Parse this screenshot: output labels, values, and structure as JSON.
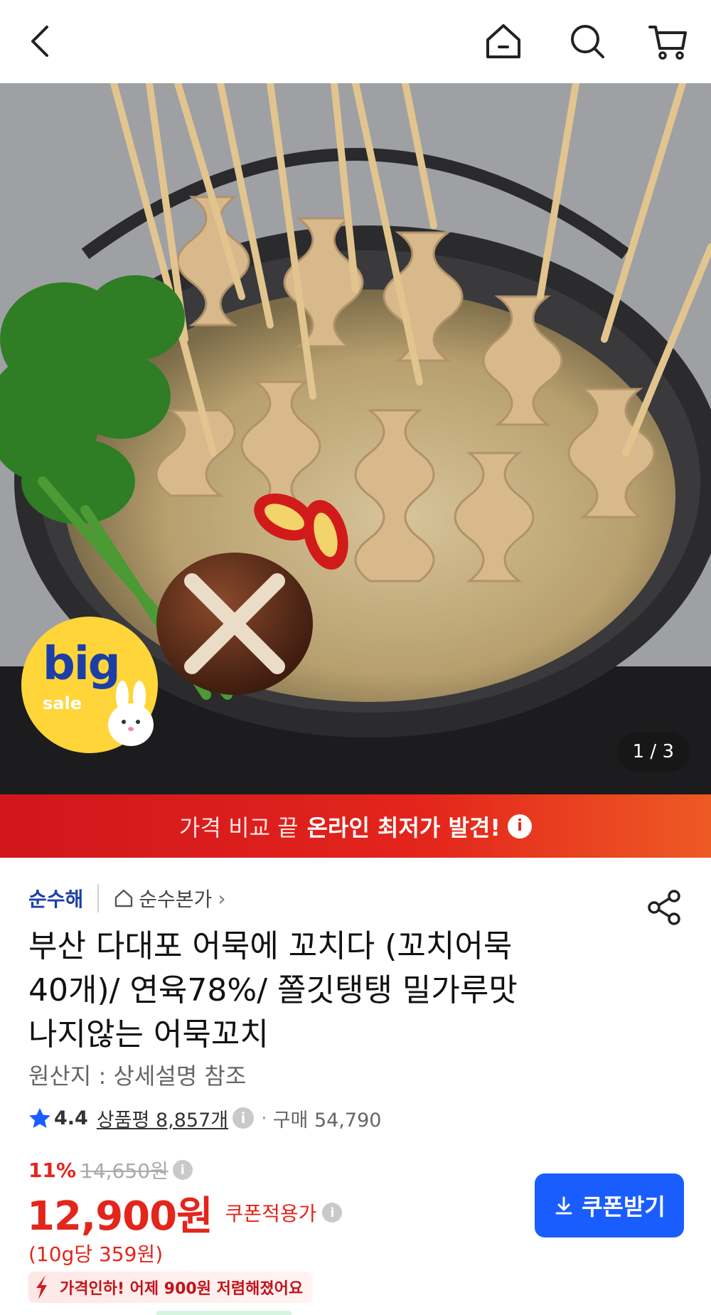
{
  "nav": {
    "back": "back-icon",
    "home": "home-icon",
    "search": "search-icon",
    "cart": "cart-icon"
  },
  "hero": {
    "badge_big": "big",
    "badge_sale": "sale",
    "page_indicator": "1 / 3"
  },
  "banner": {
    "text_normal": "가격 비교 끝",
    "text_strong": "온라인 최저가 발견!",
    "info": "i"
  },
  "product": {
    "seller": "순수해",
    "brand": "순수본가",
    "brand_chevron": "›",
    "title_lines": [
      "부산 다대포 어묵에 꼬치다 (꼬치어묵",
      "40개)/ 연육78%/ 쫄깃탱탱 밀가루맛",
      "나지않는 어묵꼬치"
    ],
    "origin": "원산지 : 상세설명 참조",
    "rating": "4.4",
    "reviews": "상품평 8,857개",
    "sales_separator": "·",
    "sales": "구매 54,790",
    "discount_percent": "11%",
    "original_price": "14,650원",
    "price": "12,900원",
    "coupon_price_label": "쿠폰적용가",
    "unit_price": "(10g당 359원)",
    "price_drop": "가격인하! 어제 900원 저렴해졌어요",
    "coupon_button": "쿠폰받기",
    "info": "i"
  },
  "colors": {
    "accent_red": "#e3251c",
    "accent_blue": "#1a5dff",
    "seller_blue": "#1c3fa6",
    "badge_yellow": "#ffd53a"
  }
}
